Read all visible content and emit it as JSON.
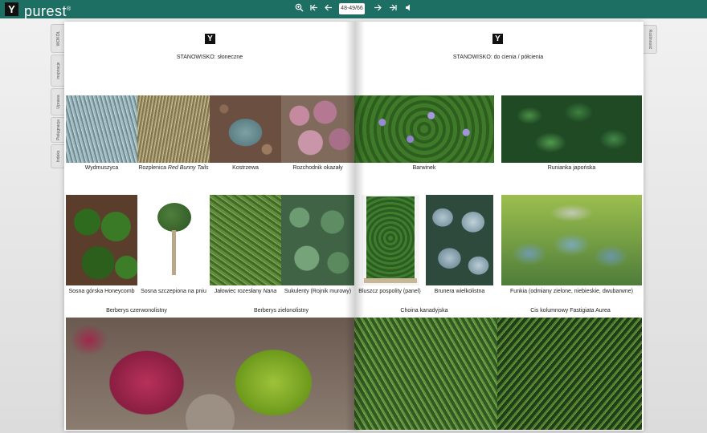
{
  "app": {
    "logo_glyph": "Y",
    "name": "purest",
    "registered": "®"
  },
  "toolbar": {
    "zoom_icon": "zoom-in-icon",
    "page_indicator": "48-49/66",
    "icons": [
      "zoom-in-icon",
      "first-page-icon",
      "prev-page-icon",
      "next-page-icon",
      "last-page-icon",
      "sound-icon"
    ]
  },
  "side_tabs": [
    "WOKÓŁ",
    "inspiracje",
    "Uprawa",
    "Pielęgnacja",
    "Indeks"
  ],
  "right_tab": "Roślinność",
  "left_page": {
    "logo": "Y",
    "heading": "STANOWISKO: słoneczne",
    "captions_row1": [
      "Wydmuszyca",
      "Rozplenica ",
      "Red Bunny Tails",
      "Kostrzewa",
      "Rozchodnik okazały"
    ],
    "captions_row2": [
      "Sosna górska Honeycomb",
      "Sosna szczepiona na pniu",
      "Jałowiec rozesłany ",
      "Nana",
      "Sukulenty (Rojnik murowy)"
    ],
    "captions_row3": [
      "Berberys czerwonolistny",
      "Berberys zielonolistny"
    ]
  },
  "right_page": {
    "logo": "Y",
    "heading": "STANOWISKO: do cienia / półcienia",
    "captions_row1": [
      "Barwinek",
      "Runianka japońska"
    ],
    "captions_row2": [
      "Bluszcz pospolity (panel)",
      "Brunera wielkolistna",
      "Funkia (odmiany zielone, niebieskie, dwubarwne)"
    ],
    "captions_row3": [
      "Choina kanadyjska",
      "Cis kolumnowy Fastigiata Aurea"
    ]
  },
  "colors": {
    "topbar": "#1e6f63",
    "page": "#ffffff"
  }
}
